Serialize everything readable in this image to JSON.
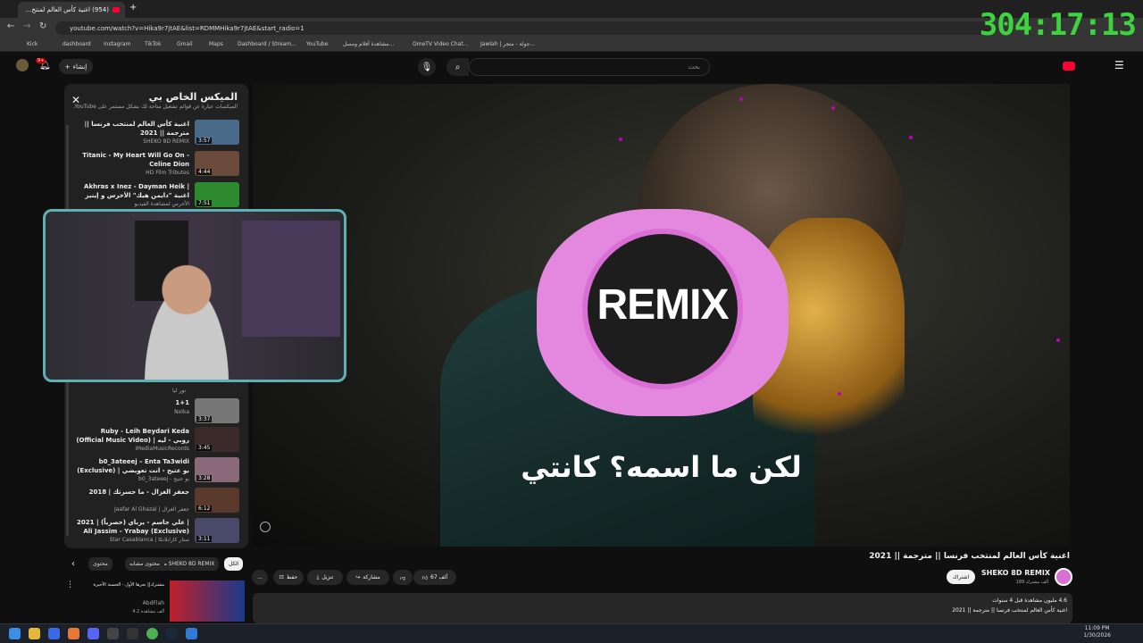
{
  "browser": {
    "tab_title": "(954) اغنية كأس العالم لمنتخ...",
    "url": "youtube.com/watch?v=Hika9r7jtAE&list=RDMMHika9r7jtAE&start_radio=1",
    "bookmarks": [
      "Kick",
      "dashboard",
      "instagram",
      "TikTok",
      "Gmail",
      "Maps",
      "Dashboard / Stream...",
      "YouTube",
      "مشاهدة أفلام ومسل...",
      "OmeTV Video Chat...",
      "Jawlah | جولة - متجر..."
    ]
  },
  "overlay": {
    "timer": "304:17:13"
  },
  "youtube": {
    "create_label": "إنشاء",
    "notif_count": "9+",
    "search_placeholder": "بحث"
  },
  "playlist": {
    "title": "الميكس الخاص بي",
    "desc": "الميكسات عبارة عن قوائم تشغيل متاحة لك بشكل مستمر على YouTube.",
    "items": [
      {
        "title": "اغنية كأس العالم لمنتخب فرنسا || مترجمة || 2021",
        "channel": "SHEKO 8D REMIX",
        "dur": "3:57"
      },
      {
        "title": "Titanic - My Heart Will Go On - Celine Dion",
        "channel": "HD Film Tributes",
        "dur": "4:44"
      },
      {
        "title": "Akhras x Inez - Dayman Heik | اغنية \"دايمن هيك\" الأخرس و إينيز",
        "channel": "الأخرس لمشاهدة الفيديو",
        "dur": "7:51"
      },
      {
        "title": "1+1",
        "channel": "Nolka",
        "dur": "3:37"
      },
      {
        "title": "Ruby - Leih Beydari Keda (Official Music Video) | روبي - ليه",
        "channel": "iMediaMusicRecords",
        "dur": "3:45"
      },
      {
        "title": "b0_3ateeej – Enta Ta3widi (Exclusive) | بو عتيج - انت تعويضي",
        "channel": "b0_3ateeej - بو عتيج",
        "dur": "3:28"
      },
      {
        "title": "جعفر الغزال - ما حسرتك | 2018",
        "channel": "Jaafar Al Ghazal | جعفر الغزال",
        "dur": "6:12"
      },
      {
        "title": "علي جاسم - يرباي (حصرياً) | 2021 | Ali Jassim - Yrabay (Exclusive)",
        "channel": "Star Casablanca | ستار كازابلانكا",
        "dur": "3:11"
      }
    ],
    "hidden_channel": "نور ليا"
  },
  "video": {
    "logo_text": "REMIX",
    "subtitle": "لكن ما اسمه؟ كانتي",
    "title": "اغنية كأس العالم لمنتخب فرنسا || مترجمة || 2021",
    "channel": "SHEKO 8D REMIX",
    "subscribers": "189 ألف مشترك",
    "subscribe_label": "اشتراك",
    "likes": "67 ألف",
    "share_label": "مشاركة",
    "download_label": "تنزيل",
    "save_label": "حفظ",
    "more_label": "...",
    "views_line": "4.6 مليون مشاهدة قبل 4 سنوات",
    "desc_line": "اغنية كأس العالم لمنتخب فرنسا || مترجمة || 2021"
  },
  "chips": [
    "الكل",
    "من SHEKO 8D REMIX",
    "محتوى مشابه",
    "محتوى"
  ],
  "recommended": {
    "title": "مشترك|| بحرها الأول - الحسنة الأخيرة",
    "channel": "AbdFlah",
    "meta": "4.2 ألف مشاهدة"
  },
  "taskbar": {
    "time": "11:09 PM",
    "date": "1/30/2026"
  },
  "colors": {
    "accent_pink": "#e487de",
    "yt_red": "#ff0033",
    "timer_green": "#3ed33e",
    "cam_border": "#5fb0b4"
  }
}
